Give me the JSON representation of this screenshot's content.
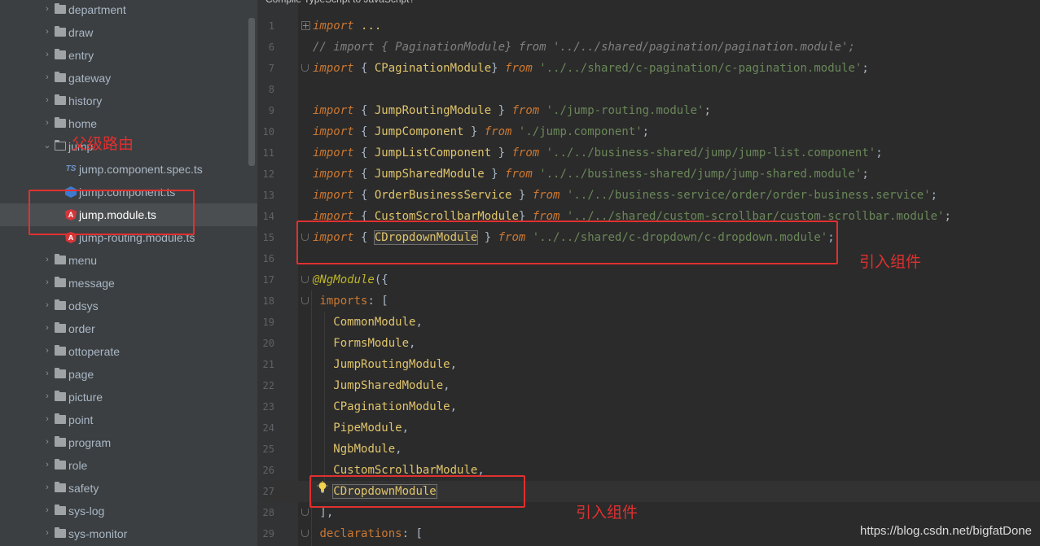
{
  "editor_header": "Compile TypeScript to JavaScript?",
  "sidebar": {
    "folders_top": [
      "department",
      "draw",
      "entry",
      "gateway",
      "history",
      "home"
    ],
    "open_folder": "jump",
    "files": [
      {
        "name": "jump.component.spec.ts",
        "icon": "test-file-icon",
        "badge": "TS"
      },
      {
        "name": "jump.component.ts",
        "icon": "typescript-file-icon",
        "badge": ""
      },
      {
        "name": "jump.module.ts",
        "icon": "angular-file-icon",
        "badge": "A"
      },
      {
        "name": "jump-routing.module.ts",
        "icon": "angular-file-icon",
        "badge": "A"
      }
    ],
    "folders_bottom": [
      "menu",
      "message",
      "odsys",
      "order",
      "ottoperate",
      "page",
      "picture",
      "point",
      "program",
      "role",
      "safety",
      "sys-log",
      "sys-monitor"
    ],
    "selected_file": "jump.module.ts"
  },
  "code": {
    "lines": [
      {
        "n": "1",
        "fold": "plus",
        "tokens": [
          [
            "kw",
            "import"
          ],
          [
            "plain",
            " "
          ],
          [
            "cls",
            "..."
          ]
        ]
      },
      {
        "n": "6",
        "tokens": [
          [
            "cmt",
            "// import { PaginationModule} from '../../shared/pagination/pagination.module';"
          ]
        ]
      },
      {
        "n": "7",
        "fold": "end",
        "tokens": [
          [
            "kw",
            "import"
          ],
          [
            "plain",
            " { "
          ],
          [
            "cls",
            "CPaginationModule"
          ],
          [
            "plain",
            "} "
          ],
          [
            "kw",
            "from"
          ],
          [
            "plain",
            " "
          ],
          [
            "str",
            "'../../shared/c-pagination/c-pagination.module'"
          ],
          [
            "plain",
            ";"
          ]
        ]
      },
      {
        "n": "8",
        "tokens": []
      },
      {
        "n": "9",
        "tokens": [
          [
            "kw",
            "import"
          ],
          [
            "plain",
            " { "
          ],
          [
            "cls",
            "JumpRoutingModule"
          ],
          [
            "plain",
            " } "
          ],
          [
            "kw",
            "from"
          ],
          [
            "plain",
            " "
          ],
          [
            "str",
            "'./jump-routing.module'"
          ],
          [
            "plain",
            ";"
          ]
        ]
      },
      {
        "n": "10",
        "tokens": [
          [
            "kw",
            "import"
          ],
          [
            "plain",
            " { "
          ],
          [
            "cls",
            "JumpComponent"
          ],
          [
            "plain",
            " } "
          ],
          [
            "kw",
            "from"
          ],
          [
            "plain",
            " "
          ],
          [
            "str",
            "'./jump.component'"
          ],
          [
            "plain",
            ";"
          ]
        ]
      },
      {
        "n": "11",
        "tokens": [
          [
            "kw",
            "import"
          ],
          [
            "plain",
            " { "
          ],
          [
            "cls",
            "JumpListComponent"
          ],
          [
            "plain",
            " } "
          ],
          [
            "kw",
            "from"
          ],
          [
            "plain",
            " "
          ],
          [
            "str",
            "'../../business-shared/jump/jump-list.component'"
          ],
          [
            "plain",
            ";"
          ]
        ]
      },
      {
        "n": "12",
        "tokens": [
          [
            "kw",
            "import"
          ],
          [
            "plain",
            " { "
          ],
          [
            "cls",
            "JumpSharedModule"
          ],
          [
            "plain",
            " } "
          ],
          [
            "kw",
            "from"
          ],
          [
            "plain",
            " "
          ],
          [
            "str",
            "'../../business-shared/jump/jump-shared.module'"
          ],
          [
            "plain",
            ";"
          ]
        ]
      },
      {
        "n": "13",
        "tokens": [
          [
            "kw",
            "import"
          ],
          [
            "plain",
            " { "
          ],
          [
            "cls",
            "OrderBusinessService"
          ],
          [
            "plain",
            " } "
          ],
          [
            "kw",
            "from"
          ],
          [
            "plain",
            " "
          ],
          [
            "str",
            "'../../business-service/order/order-business.service'"
          ],
          [
            "plain",
            ";"
          ]
        ]
      },
      {
        "n": "14",
        "tokens": [
          [
            "kw",
            "import"
          ],
          [
            "plain",
            " { "
          ],
          [
            "cls",
            "CustomScrollbarModule"
          ],
          [
            "plain",
            "} "
          ],
          [
            "kw",
            "from"
          ],
          [
            "plain",
            " "
          ],
          [
            "str",
            "'../../shared/custom-scrollbar/custom-scrollbar.module'"
          ],
          [
            "plain",
            ";"
          ]
        ]
      },
      {
        "n": "15",
        "fold": "end",
        "tokens": [
          [
            "kw",
            "import"
          ],
          [
            "plain",
            " { "
          ],
          [
            "cls hl",
            "CDropdownModule"
          ],
          [
            "plain",
            " } "
          ],
          [
            "kw",
            "from"
          ],
          [
            "plain",
            " "
          ],
          [
            "str",
            "'../../shared/c-dropdown/c-dropdown.module'"
          ],
          [
            "plain",
            ";"
          ]
        ]
      },
      {
        "n": "16",
        "tokens": []
      },
      {
        "n": "17",
        "fold": "end",
        "tokens": [
          [
            "dec",
            "@NgModule"
          ],
          [
            "plain",
            "({"
          ]
        ]
      },
      {
        "n": "18",
        "fold": "end",
        "tokens": [
          [
            "plain",
            " "
          ],
          [
            "prop",
            "imports"
          ],
          [
            "plain",
            ": ["
          ]
        ]
      },
      {
        "n": "19",
        "tokens": [
          [
            "plain",
            "   "
          ],
          [
            "cls",
            "CommonModule"
          ],
          [
            "plain",
            ","
          ]
        ]
      },
      {
        "n": "20",
        "tokens": [
          [
            "plain",
            "   "
          ],
          [
            "cls",
            "FormsModule"
          ],
          [
            "plain",
            ","
          ]
        ]
      },
      {
        "n": "21",
        "tokens": [
          [
            "plain",
            "   "
          ],
          [
            "cls",
            "JumpRoutingModule"
          ],
          [
            "plain",
            ","
          ]
        ]
      },
      {
        "n": "22",
        "tokens": [
          [
            "plain",
            "   "
          ],
          [
            "cls",
            "JumpSharedModule"
          ],
          [
            "plain",
            ","
          ]
        ]
      },
      {
        "n": "23",
        "tokens": [
          [
            "plain",
            "   "
          ],
          [
            "cls",
            "CPaginationModule"
          ],
          [
            "plain",
            ","
          ]
        ]
      },
      {
        "n": "24",
        "tokens": [
          [
            "plain",
            "   "
          ],
          [
            "cls",
            "PipeModule"
          ],
          [
            "plain",
            ","
          ]
        ]
      },
      {
        "n": "25",
        "tokens": [
          [
            "plain",
            "   "
          ],
          [
            "cls",
            "NgbModule"
          ],
          [
            "plain",
            ","
          ]
        ]
      },
      {
        "n": "26",
        "tokens": [
          [
            "plain",
            "   "
          ],
          [
            "cls",
            "CustomScrollbarModule"
          ],
          [
            "plain",
            ","
          ]
        ]
      },
      {
        "n": "27",
        "current": true,
        "tokens": [
          [
            "plain",
            "   "
          ],
          [
            "cls hl",
            "CDropdownModule"
          ]
        ]
      },
      {
        "n": "28",
        "fold": "end",
        "tokens": [
          [
            "plain",
            " ],"
          ]
        ]
      },
      {
        "n": "29",
        "fold": "end",
        "tokens": [
          [
            "plain",
            " "
          ],
          [
            "prop",
            "declarations"
          ],
          [
            "plain",
            ": ["
          ]
        ]
      }
    ]
  },
  "annotations": {
    "parent_route": "父级路由",
    "import_component_top": "引入组件",
    "import_component_bottom": "引入组件"
  },
  "watermark": "https://blog.csdn.net/bigfatDone"
}
